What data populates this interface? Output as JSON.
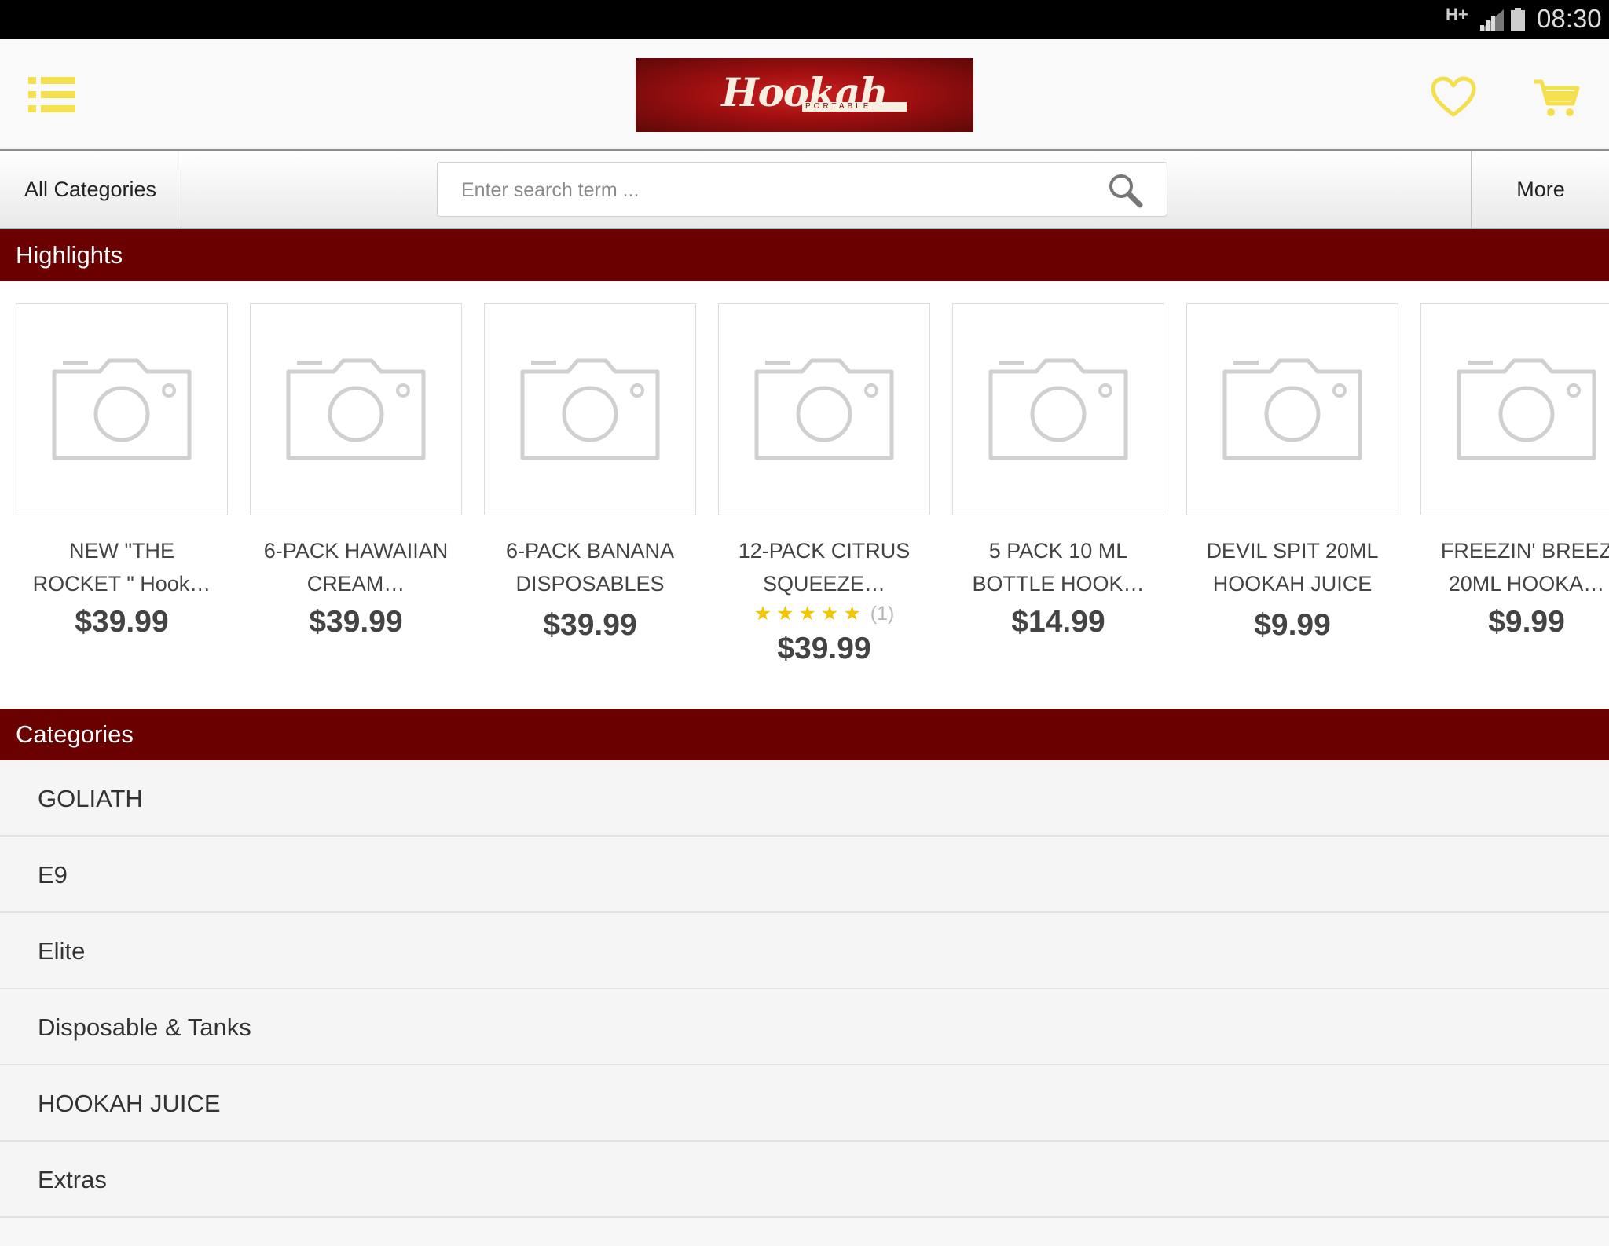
{
  "status_bar": {
    "network": "H+",
    "time": "08:30"
  },
  "header": {
    "logo_text": "Hookah",
    "logo_subtext": "PORTABLE"
  },
  "search_bar": {
    "all_categories_label": "All Categories",
    "search_placeholder": "Enter search term ...",
    "more_label": "More"
  },
  "highlights": {
    "title": "Highlights",
    "products": [
      {
        "name": "NEW \"THE\nROCKET \" Hook…",
        "price": "$39.99"
      },
      {
        "name": "6-PACK HAWAIIAN\nCREAM…",
        "price": "$39.99"
      },
      {
        "name": "6-PACK BANANA\nDISPOSABLES",
        "price": "$39.99"
      },
      {
        "name": "12-PACK CITRUS\nSQUEEZE…",
        "price": "$39.99",
        "rating": 5,
        "rating_stars": "★★★★★",
        "rating_count": "(1)"
      },
      {
        "name": "5 PACK 10 ML\nBOTTLE HOOK…",
        "price": "$14.99"
      },
      {
        "name": "DEVIL SPIT 20ML\nHOOKAH JUICE",
        "price": "$9.99"
      },
      {
        "name": "FREEZIN' BREEZ\n20ML HOOKA…",
        "price": "$9.99"
      }
    ]
  },
  "categories": {
    "title": "Categories",
    "items": [
      {
        "label": "GOLIATH"
      },
      {
        "label": "E9"
      },
      {
        "label": "Elite"
      },
      {
        "label": "Disposable & Tanks"
      },
      {
        "label": "HOOKAH JUICE"
      },
      {
        "label": "Extras"
      }
    ]
  },
  "colors": {
    "accent_yellow": "#f4e04d",
    "section_header": "#6b0000",
    "rating_star": "#f5c400"
  },
  "icons": {
    "menu": "list-menu-icon",
    "wishlist": "heart-icon",
    "cart": "cart-icon",
    "search": "magnifier-icon",
    "product_placeholder": "camera-icon"
  }
}
